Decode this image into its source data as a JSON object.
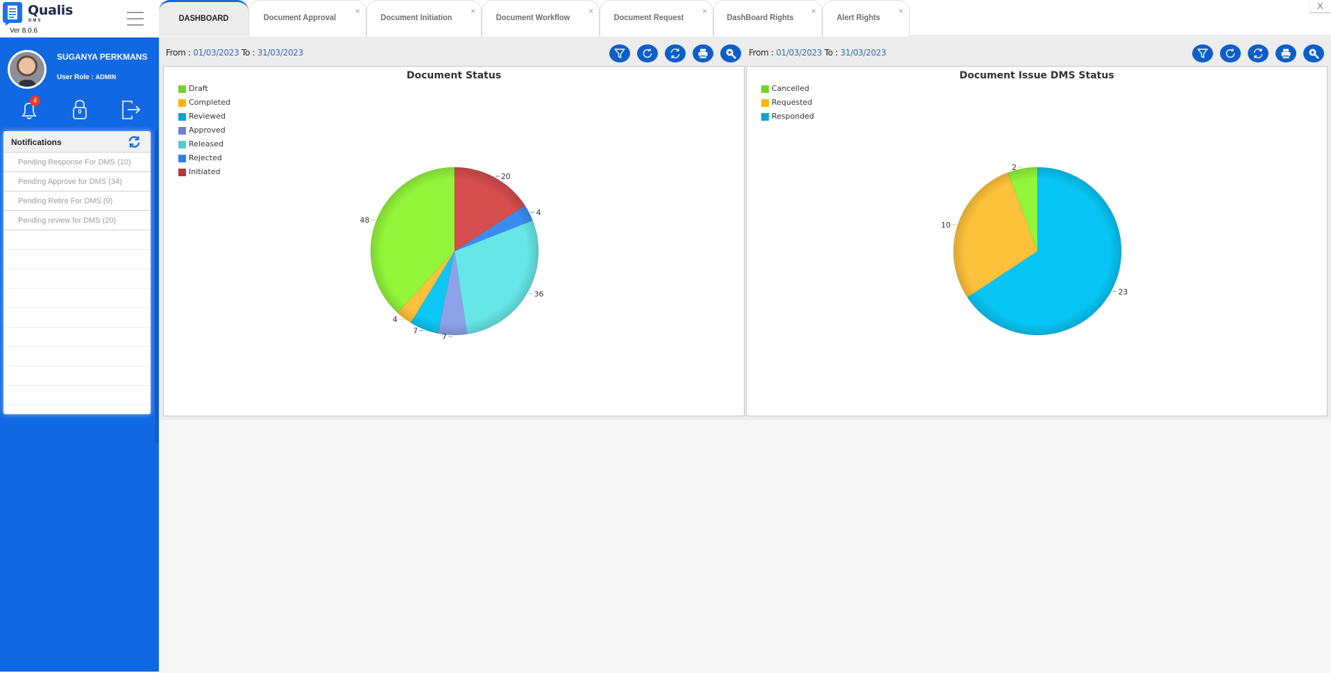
{
  "app": {
    "name": "Qualis",
    "subtitle": "DMS",
    "version": "Ver 8.0.6",
    "window_close": "X"
  },
  "user": {
    "name": "SUGANYA PERKMANS",
    "role_label": "User Role : ",
    "role": "ADMIN",
    "notifications_count": "4",
    "locked_count": "0"
  },
  "notifications": {
    "title": "Notifications",
    "items": [
      "Pending Response For DMS (10)",
      "Pending Approve for DMS (34)",
      "Pending Retire For DMS (9)",
      "Pending review for DMS (20)"
    ]
  },
  "tabs": [
    {
      "label": "DASHBOARD",
      "active": true,
      "closable": false
    },
    {
      "label": "Document Approval",
      "active": false,
      "closable": true
    },
    {
      "label": "Document Initiation",
      "active": false,
      "closable": true
    },
    {
      "label": "Document Workflow",
      "active": false,
      "closable": true
    },
    {
      "label": "Document Request",
      "active": false,
      "closable": true
    },
    {
      "label": "DashBoard Rights",
      "active": false,
      "closable": true
    },
    {
      "label": "Alert Rights",
      "active": false,
      "closable": true
    }
  ],
  "tab_close_glyph": "×",
  "filters": [
    {
      "from_label": "From : ",
      "from": "01/03/2023",
      "to_label": " To : ",
      "to": "31/03/2023"
    },
    {
      "from_label": "From : ",
      "from": "01/03/2023",
      "to_label": " To : ",
      "to": "31/03/2023"
    }
  ],
  "toolbar_icons": [
    "filter-icon",
    "reload-icon",
    "sync-icon",
    "print-icon",
    "zoom-in-icon"
  ],
  "colors": {
    "sidebar": "#1068e3",
    "toolbar_button": "#0d5fc8",
    "date_text": "#2f6fb9"
  },
  "chart_data": [
    {
      "type": "pie",
      "title": "Document Status",
      "legend_position": "top-left",
      "legend": [
        {
          "label": "Draft",
          "color": "#77d42a"
        },
        {
          "label": "Completed",
          "color": "#ffb300"
        },
        {
          "label": "Reviewed",
          "color": "#0aa3d6"
        },
        {
          "label": "Approved",
          "color": "#6c7fd0"
        },
        {
          "label": "Released",
          "color": "#4ecccc"
        },
        {
          "label": "Rejected",
          "color": "#2f80e6"
        },
        {
          "label": "Initiated",
          "color": "#b33a3a"
        }
      ],
      "slices": [
        {
          "label": "Initiated",
          "value": 20,
          "color": "#d54d4d"
        },
        {
          "label": "Rejected",
          "value": 4,
          "color": "#3c8bf5"
        },
        {
          "label": "Released",
          "value": 36,
          "color": "#66e6e6"
        },
        {
          "label": "Approved",
          "value": 7,
          "color": "#8ea2ea"
        },
        {
          "label": "Reviewed",
          "value": 7,
          "color": "#0dc7f5"
        },
        {
          "label": "Completed",
          "value": 4,
          "color": "#ffc23a"
        },
        {
          "label": "Draft",
          "value": 48,
          "color": "#92f53a"
        }
      ]
    },
    {
      "type": "pie",
      "title": "Document Issue DMS Status",
      "legend_position": "top-left",
      "legend": [
        {
          "label": "Cancelled",
          "color": "#77d42a"
        },
        {
          "label": "Requested",
          "color": "#ffb300"
        },
        {
          "label": "Responded",
          "color": "#0aa3d6"
        }
      ],
      "slices": [
        {
          "label": "Responded",
          "value": 23,
          "color": "#06c5f5"
        },
        {
          "label": "Requested",
          "value": 10,
          "color": "#ffc23a"
        },
        {
          "label": "Cancelled",
          "value": 2,
          "color": "#92f53a"
        }
      ]
    }
  ]
}
